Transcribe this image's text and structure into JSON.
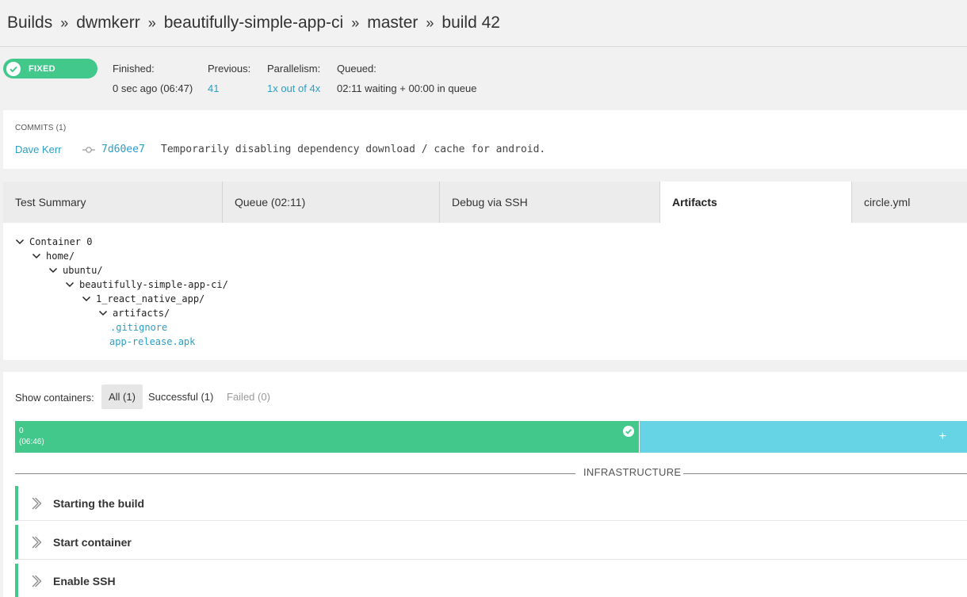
{
  "breadcrumb": [
    "Builds",
    "dwmkerr",
    "beautifully-simple-app-ci",
    "master",
    "build 42"
  ],
  "breadcrumb_separator": "»",
  "status_badge": "FIXED",
  "build_info": {
    "finished_label": "Finished:",
    "finished_value": "0 sec ago (06:47)",
    "previous_label": "Previous:",
    "previous_value": "41",
    "parallelism_label": "Parallelism:",
    "parallelism_value": "1x out of 4x",
    "queued_label": "Queued:",
    "queued_value": "02:11 waiting + 00:00 in queue"
  },
  "commits": {
    "title": "COMMITS (1)",
    "author": "Dave Kerr",
    "sha": "7d60ee7",
    "message": "Temporarily disabling dependency download / cache for android."
  },
  "tabs": [
    "Test Summary",
    "Queue (02:11)",
    "Debug via SSH",
    "Artifacts",
    "circle.yml"
  ],
  "artifacts": {
    "container": "Container 0",
    "folders": [
      "home/",
      "ubuntu/",
      "beautifully-simple-app-ci/",
      "1_react_native_app/",
      "artifacts/"
    ],
    "files": [
      ".gitignore",
      "app-release.apk"
    ]
  },
  "containers": {
    "show_label": "Show containers:",
    "filters": [
      "All (1)",
      "Successful (1)",
      "Failed (0)"
    ],
    "bar_index": "0",
    "bar_time": "(06:46)",
    "add_label": "+"
  },
  "infrastructure_label": "INFRASTRUCTURE",
  "steps": [
    "Starting the build",
    "Start container",
    "Enable SSH"
  ],
  "colors": {
    "success": "#42c88a",
    "link": "#2a9fc7",
    "pending": "#67d4e6"
  }
}
